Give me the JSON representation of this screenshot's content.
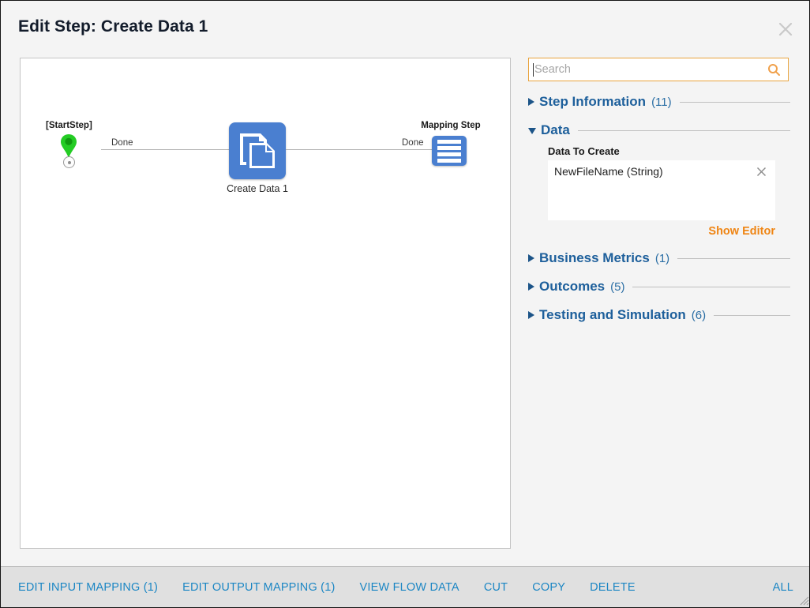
{
  "window": {
    "title": "Edit Step: Create Data 1",
    "close_icon": "close-icon"
  },
  "canvas": {
    "nodes": [
      {
        "id": "start",
        "label": "[StartStep]",
        "icon": "green-pin-icon"
      },
      {
        "id": "create_data",
        "label": "Create Data 1",
        "icon": "create-data-icon"
      },
      {
        "id": "mapping",
        "label": "Mapping Step",
        "icon": "mapping-step-icon"
      }
    ],
    "connectors": [
      {
        "label": "Done",
        "from": "start",
        "to": "create_data"
      },
      {
        "label": "Done",
        "from": "create_data",
        "to": "mapping"
      }
    ]
  },
  "panel": {
    "search": {
      "placeholder": "Search",
      "value": "",
      "icon": "search-icon"
    },
    "sections": [
      {
        "title": "Step Information",
        "count": "(11)",
        "expanded": false
      },
      {
        "title": "Data",
        "count": "",
        "expanded": true
      },
      {
        "title": "Business Metrics",
        "count": "(1)",
        "expanded": false
      },
      {
        "title": "Outcomes",
        "count": "(5)",
        "expanded": false
      },
      {
        "title": "Testing and Simulation",
        "count": "(6)",
        "expanded": false
      }
    ],
    "data_section": {
      "subtitle": "Data To Create",
      "items": [
        {
          "label": "NewFileName (String)",
          "remove_icon": "close-icon"
        }
      ],
      "show_editor_label": "Show Editor"
    }
  },
  "footer": {
    "buttons": [
      "EDIT INPUT MAPPING (1)",
      "EDIT OUTPUT MAPPING (1)",
      "VIEW FLOW DATA",
      "CUT",
      "COPY",
      "DELETE"
    ],
    "all_label": "ALL"
  },
  "colors": {
    "accent_orange": "#ef8412",
    "section_blue": "#1d5f9b",
    "footer_blue": "#1b86c4",
    "node_blue": "#4a7fd0",
    "start_green": "#24cc24"
  }
}
